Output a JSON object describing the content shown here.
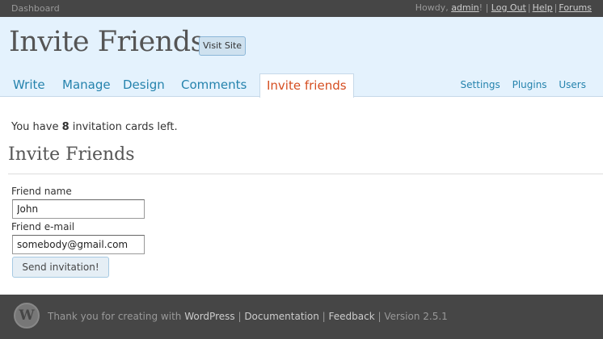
{
  "topbar": {
    "dashboard": "Dashboard",
    "howdy": "Howdy, ",
    "user": "admin",
    "howdy_end": "! |",
    "logout": "Log Out",
    "help": "Help",
    "forums": "Forums"
  },
  "header": {
    "site_title": "Invite Friends",
    "visit_site": "Visit Site",
    "tabs": [
      {
        "label": "Write"
      },
      {
        "label": "Manage"
      },
      {
        "label": "Design"
      },
      {
        "label": "Comments"
      },
      {
        "label": "Invite friends"
      }
    ],
    "side_links": [
      {
        "label": "Settings"
      },
      {
        "label": "Plugins"
      },
      {
        "label": "Users"
      }
    ]
  },
  "main": {
    "invites_prefix": "You have ",
    "invites_count": "8",
    "invites_suffix": " invitation cards left.",
    "section_title": "Invite Friends",
    "name_label": "Friend name",
    "name_value": "John",
    "email_label": "Friend e-mail",
    "email_value": "somebody@gmail.com",
    "send_label": "Send invitation!"
  },
  "footer": {
    "logo_letter": "W",
    "thanks": "Thank you for creating with ",
    "wordpress": "WordPress",
    "documentation": "Documentation",
    "feedback": "Feedback",
    "version": "Version 2.5.1"
  }
}
